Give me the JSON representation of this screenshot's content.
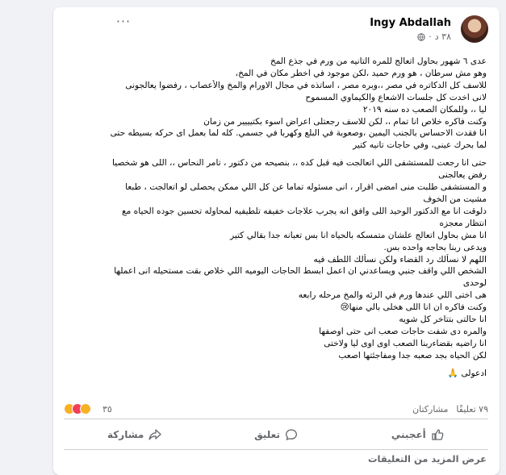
{
  "post": {
    "author": "Ingy Abdallah",
    "time": "٣٨ د",
    "privacy_icon": "globe-icon",
    "body_lines": [
      "عدى ٦ شهور بحاول اتعالج للمره التانيه من ورم في جذع المخ",
      "وهو مش سرطان ، هو ورم حميد ،لكن موجود في اخطر مكان في المخ،",
      "للاسف كل الدكاتره في مصر ،،وبره مصر ، اساتذه في مجال الاورام والمخ والأعصاب ، رفضوا يعالجونى",
      "لانى اخدت كل جلسات الاشعاع والكيماوي المسموح",
      "ليا ،، وللمكان الصعب ده سنه ٢٠١٩",
      "وكنت فاكره خلاص انا تمام ،، لكن للاسف رجعتلى اعراض اسوء بكتيييير من زمان",
      "انا فقدت الاحساس بالجنب اليمين ،وصعوبة في البلع وكهربا في جسمي. كله لما بعمل اى حركه بسيطه حتى",
      "لما بحرك عينى، وفي حاجات تانيه كتير",
      "",
      "حتى انا رجعت للمستشفى اللي اتعالجت فيه قبل كده ،، بنصيحه من دكتور ، تامر النحاس ،، اللى هو شخصيا",
      "رفض يعالجنى",
      "و المستشفى طلبت منى امضى اقرار ، انى مسئوله تماما عن كل اللي ممكن يحصلى لو اتعالجت ، طبعا",
      "مشيت من الخوف",
      "دلوقت انا مع الدكتور الوحيد اللى وافق انه يجرب علاجات خفيفه تلطيفيه لمحاوله تحسين جوده الحياه مع",
      "انتظار معجزه",
      "انا مش بحاول اتعالج علشان متمسكه بالحياه انا بس تعبانه جدا بقالي كتير",
      "ويدعى ربنا بحاجه واحده بس.",
      "اللهم لا نسألك رد القضاء ولكن نسألك اللطف فيه",
      "الشخص اللي واقف جنبي ويساعدني ان اعمل ابسط الحاجات اليوميه اللي خلاص بقت مستحيله انى اعملها",
      "لوحدى",
      "هى اختى اللي عندها ورم في الرئه والمخ مرحله رابعه",
      "وكنت فاكره ان انا اللى هخلى بالي منها😢",
      "انا حالتى بتتاخر كل شويه",
      "والمره دى شفت حاجات صعب انى حتى اوصفها",
      "انا راضيه بقضاءربنا الصعب اوى اوى ليا ولاختى",
      "لكن الحياه بجد صعبه جدا ومفاجئتها اصعب",
      "",
      "ادعولى 🙏"
    ]
  },
  "stats": {
    "reactions_count": "٣٥",
    "comments": "٧٩ تعليقًا",
    "shares": "مشاركتان"
  },
  "actions": {
    "like": "أعجبني",
    "comment": "تعليق",
    "share": "مشاركة"
  },
  "more_comments": "عرض المزيد من التعليقات"
}
